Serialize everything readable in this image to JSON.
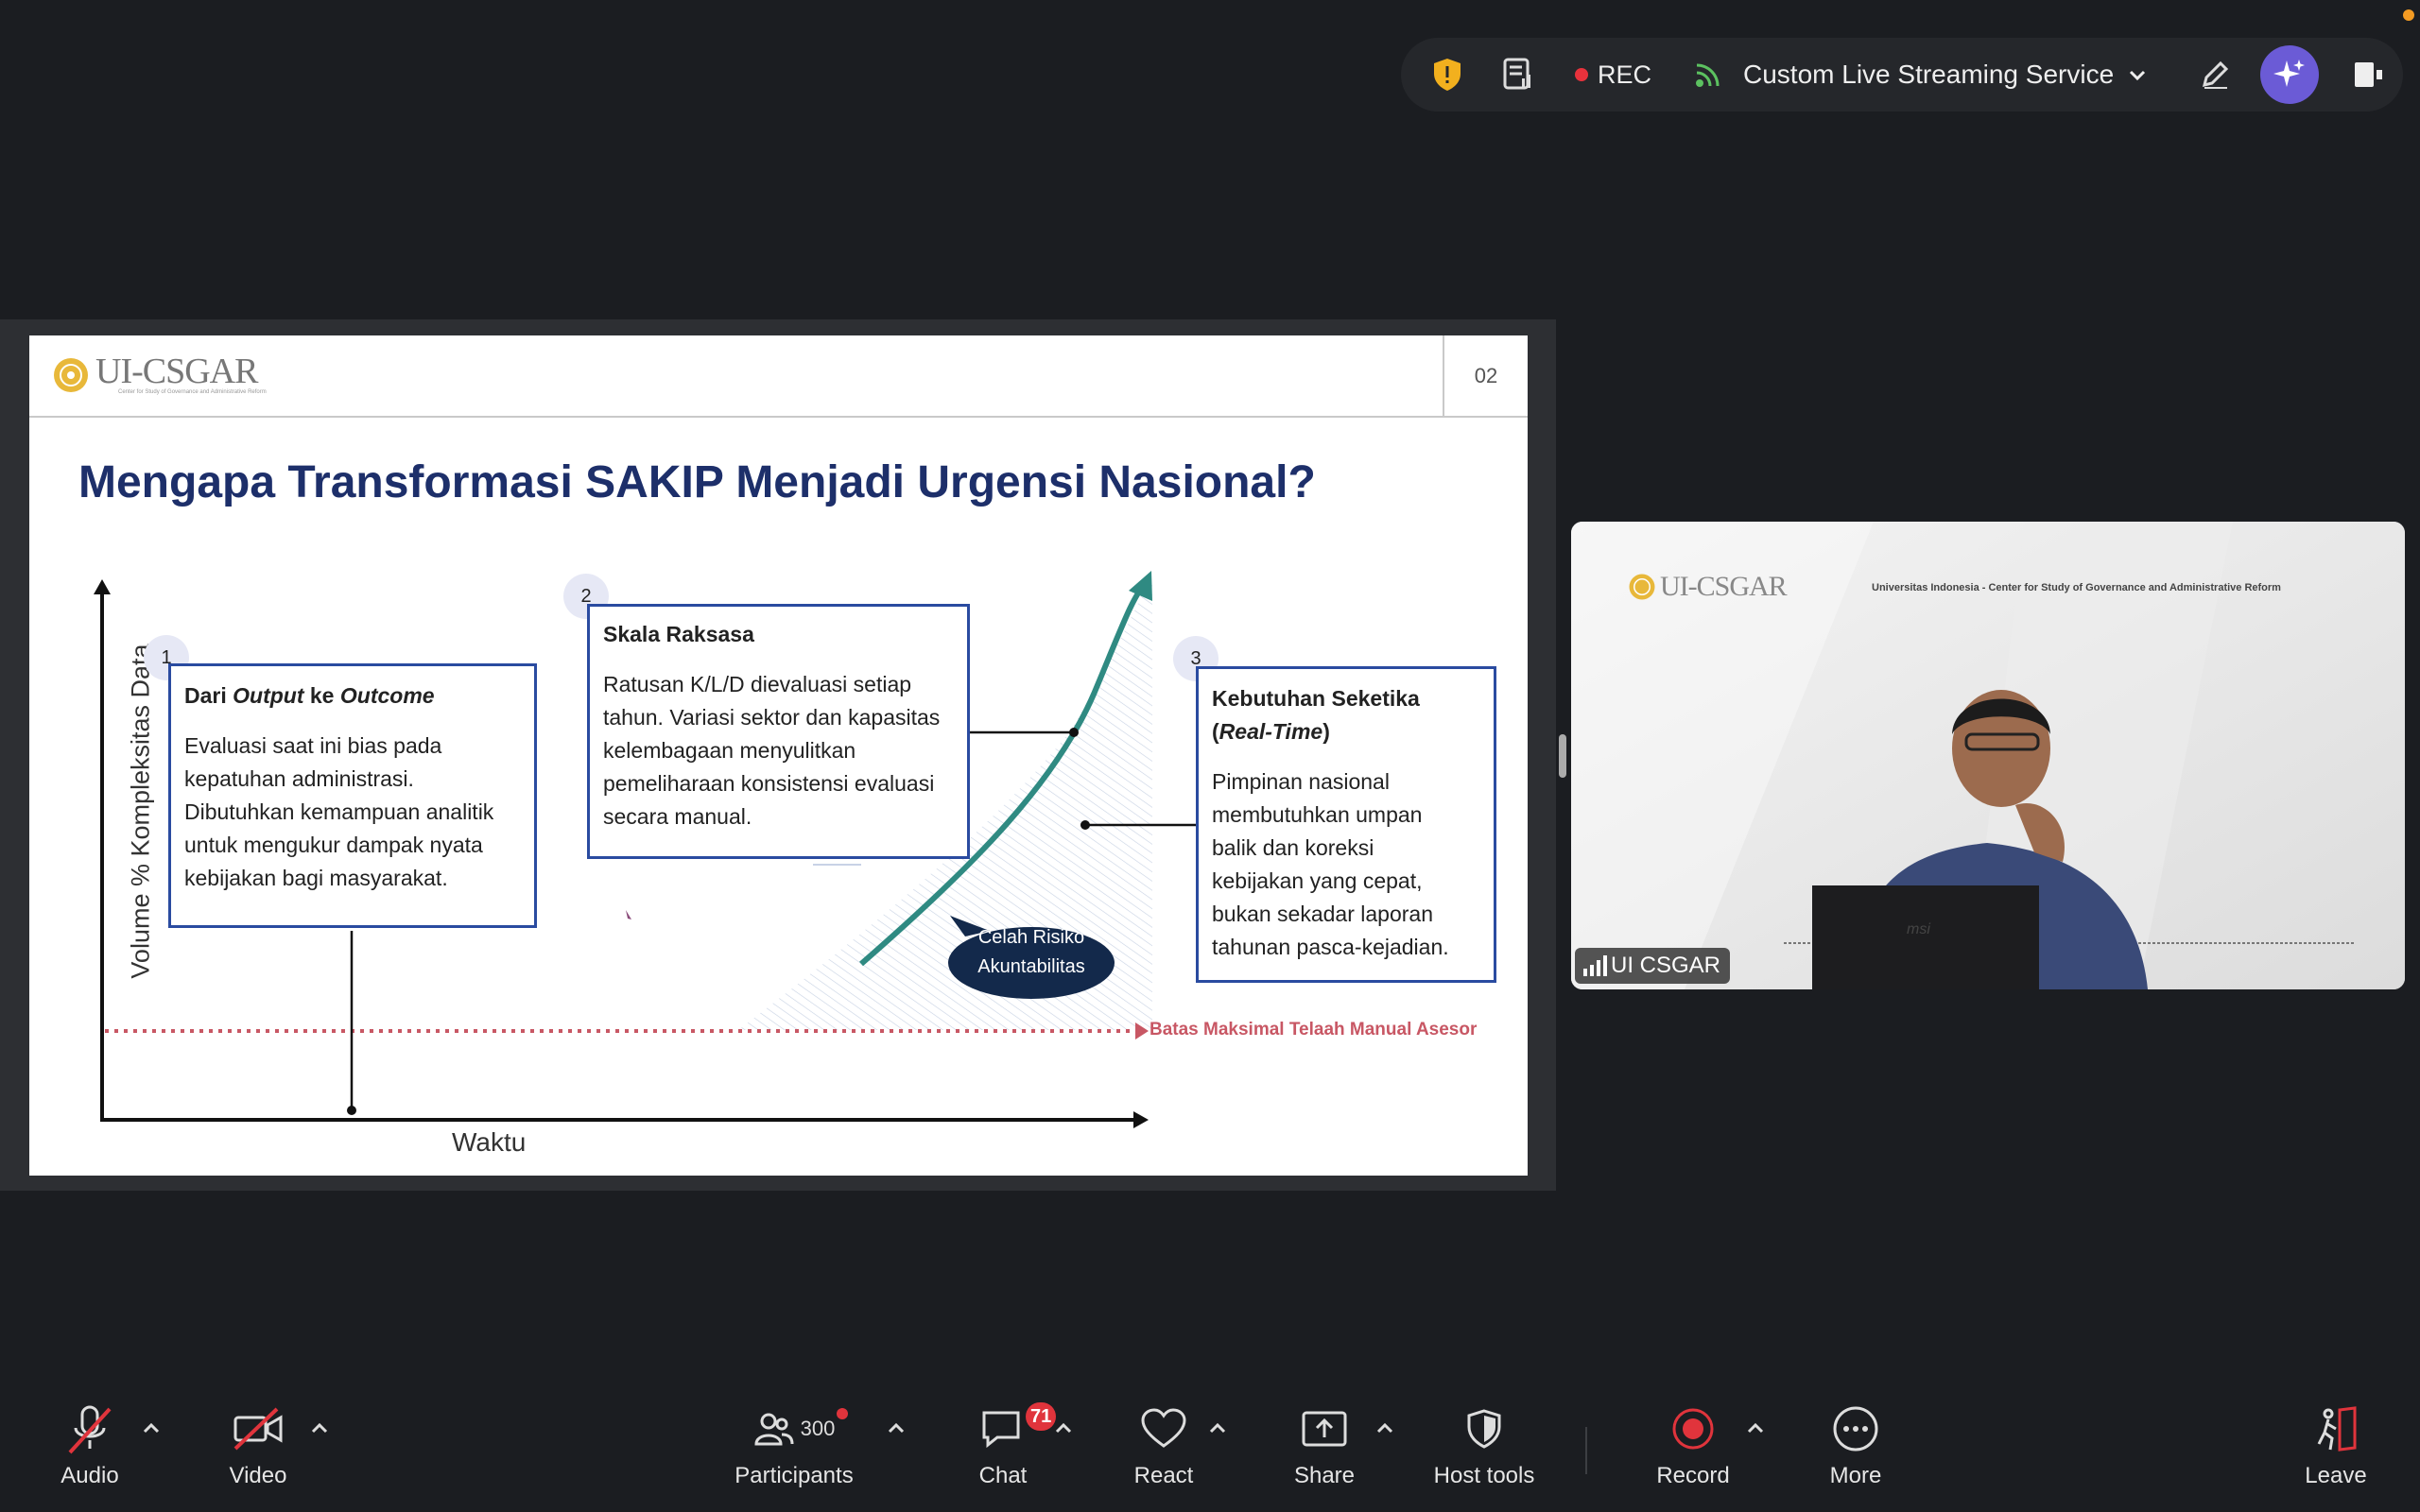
{
  "topbar": {
    "rec_label": "REC",
    "stream_label": "Custom Live Streaming Service",
    "colors": {
      "shield": "#f2b01e",
      "rec_dot": "#e8323c",
      "stream": "#5cc160",
      "ai": "#6b5bd6"
    }
  },
  "slide": {
    "logo_text": "UI-CSGAR",
    "logo_subtitle": "Center for Study of Governance and Administrative Reform",
    "page_number": "02",
    "title": "Mengapa Transformasi SAKIP Menjadi Urgensi Nasional?",
    "y_axis_label": "Volume % Kompleksitas Data",
    "x_axis_label": "Waktu",
    "limit_label": "Batas Maksimal Telaah Manual Asesor",
    "bubble_line1": "Celah Risiko",
    "bubble_line2": "Akuntabilitas",
    "box1": {
      "num": "1",
      "title_a": "Dari ",
      "title_b": "Output",
      "title_c": " ke ",
      "title_d": "Outcome",
      "lines": [
        "Evaluasi saat ini bias pada",
        "kepatuhan administrasi.",
        "Dibutuhkan kemampuan analitik",
        "untuk mengukur dampak nyata",
        "kebijakan bagi masyarakat."
      ]
    },
    "box2": {
      "num": "2",
      "title": "Skala Raksasa",
      "lines": [
        "Ratusan K/L/D dievaluasi setiap",
        "tahun. Variasi sektor dan kapasitas",
        "kelembagaan menyulitkan",
        "pemeliharaan konsistensi evaluasi",
        "secara manual."
      ]
    },
    "box3": {
      "num": "3",
      "title_a": "Kebutuhan Seketika",
      "title_b": "(",
      "title_c": "Real-Time",
      "title_d": ")",
      "lines": [
        "Pimpinan nasional",
        "membutuhkan umpan",
        "balik dan koreksi",
        "kebijakan yang cepat,",
        "bukan sekadar laporan",
        "tahunan pasca-kejadian."
      ]
    },
    "colors": {
      "title": "#1d2f6a",
      "box_border": "#2a4ba0",
      "curve": "#2f8a82",
      "limit": "#c85764",
      "bubble": "#13294b"
    }
  },
  "video": {
    "participant_name": "UI CSGAR",
    "logo_text": "UI-CSGAR",
    "banner_text": "Universitas Indonesia - Center for Study of Governance and Administrative Reform",
    "laptop_brand": "msi"
  },
  "toolbar": {
    "audio": "Audio",
    "video": "Video",
    "participants": "Participants",
    "participants_count": "300",
    "chat": "Chat",
    "chat_badge": "71",
    "react": "React",
    "share": "Share",
    "host_tools": "Host tools",
    "record": "Record",
    "more": "More",
    "leave": "Leave"
  }
}
